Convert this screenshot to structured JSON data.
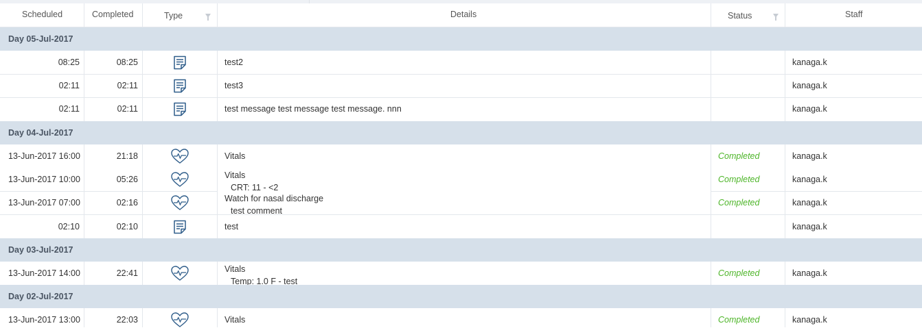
{
  "columns": {
    "scheduled": "Scheduled",
    "completed": "Completed",
    "type": "Type",
    "details": "Details",
    "status": "Status",
    "staff": "Staff"
  },
  "groups": [
    {
      "day": "Day 05-Jul-2017",
      "rows": [
        {
          "scheduled": "08:25",
          "completed": "08:25",
          "type": "note-icon",
          "details": "test2",
          "status": "",
          "staff": "kanaga.k"
        },
        {
          "scheduled": "02:11",
          "completed": "02:11",
          "type": "note-icon",
          "details": "test3",
          "status": "",
          "staff": "kanaga.k"
        },
        {
          "scheduled": "02:11",
          "completed": "02:11",
          "type": "note-icon",
          "details": "test message test message test message. nnn",
          "status": "",
          "staff": "kanaga.k"
        }
      ]
    },
    {
      "day": "Day 04-Jul-2017",
      "rows": [
        {
          "scheduled": "13-Jun-2017 16:00",
          "completed": "21:18",
          "type": "heart-pulse-icon",
          "details": "Vitals",
          "status": "Completed",
          "staff": "kanaga.k"
        },
        {
          "scheduled": "13-Jun-2017 10:00",
          "completed": "05:26",
          "type": "heart-pulse-icon",
          "details": "Vitals",
          "sub": "CRT: 11 - <2",
          "status": "Completed",
          "staff": "kanaga.k"
        },
        {
          "scheduled": "13-Jun-2017 07:00",
          "completed": "02:16",
          "type": "heart-pulse-icon",
          "details": "Watch for nasal discharge",
          "sub": "test comment",
          "status": "Completed",
          "staff": "kanaga.k"
        },
        {
          "scheduled": "02:10",
          "completed": "02:10",
          "type": "note-icon",
          "details": "test",
          "status": "",
          "staff": "kanaga.k"
        }
      ]
    },
    {
      "day": "Day 03-Jul-2017",
      "rows": [
        {
          "scheduled": "13-Jun-2017 14:00",
          "completed": "22:41",
          "type": "heart-pulse-icon",
          "details": "Vitals",
          "sub": "Temp: 1.0 F - test",
          "status": "Completed",
          "staff": "kanaga.k"
        }
      ]
    },
    {
      "day": "Day 02-Jul-2017",
      "rows": [
        {
          "scheduled": "13-Jun-2017 13:00",
          "completed": "22:03",
          "type": "heart-pulse-icon",
          "details": "Vitals",
          "status": "Completed",
          "staff": "kanaga.k"
        }
      ]
    }
  ],
  "colors": {
    "group_bg": "#d6e0ea",
    "completed": "#4db528",
    "icon": "#2f5d8a"
  }
}
